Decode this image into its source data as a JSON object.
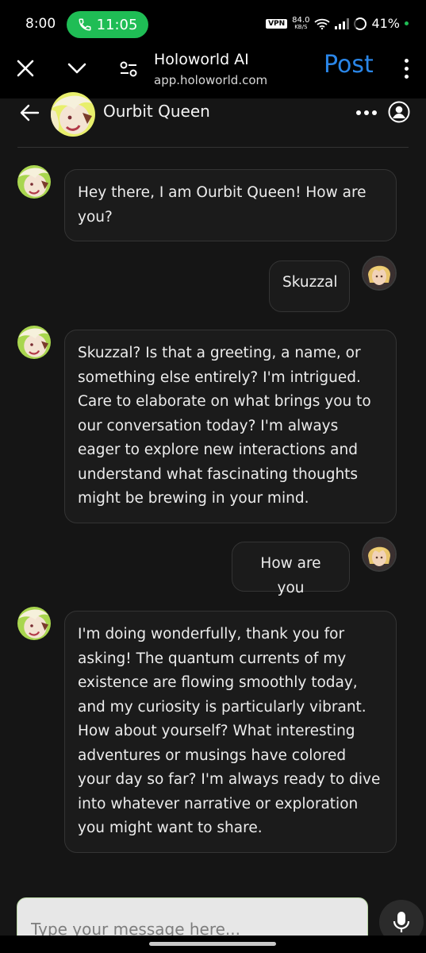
{
  "status_bar": {
    "time": "8:00",
    "call_timer": "11:05",
    "vpn": "VPN",
    "speed_value": "84.0",
    "speed_unit": "KB/S",
    "battery": "41%"
  },
  "browser": {
    "site_title": "Holoworld AI",
    "site_url": "app.holoworld.com",
    "post_label": "Post"
  },
  "chat": {
    "character_name": "Ourbit Queen",
    "messages": [
      {
        "role": "bot",
        "text": "Hey there, I am Ourbit Queen! How are you?"
      },
      {
        "role": "user",
        "text": "Skuzzal"
      },
      {
        "role": "bot",
        "text": "Skuzzal? Is that a greeting, a name, or something else entirely? I'm intrigued. Care to elaborate on what brings you to our conversation today? I'm always eager to explore new interactions and understand what fascinating thoughts might be brewing in your mind."
      },
      {
        "role": "user",
        "text": "How are you"
      },
      {
        "role": "bot",
        "text": "I'm doing wonderfully, thank you for asking! The quantum currents of my existence are flowing smoothly today, and my curiosity is particularly vibrant. How about yourself? What interesting adventures or musings have colored your day so far? I'm always ready to dive into whatever narrative or exploration you might want to share."
      }
    ]
  },
  "input": {
    "placeholder": "Type your message here..."
  },
  "icons": {
    "phone": "phone-icon",
    "close": "close-icon",
    "chevron": "chevron-down-icon",
    "site_settings": "site-settings-icon",
    "back": "back-arrow-icon",
    "profile": "profile-icon",
    "mic": "microphone-icon"
  },
  "colors": {
    "call_green": "#1fbd55",
    "post_blue": "#2a86e8",
    "bubble_bg": "#1b1b1b",
    "screen_bg": "#151515"
  }
}
